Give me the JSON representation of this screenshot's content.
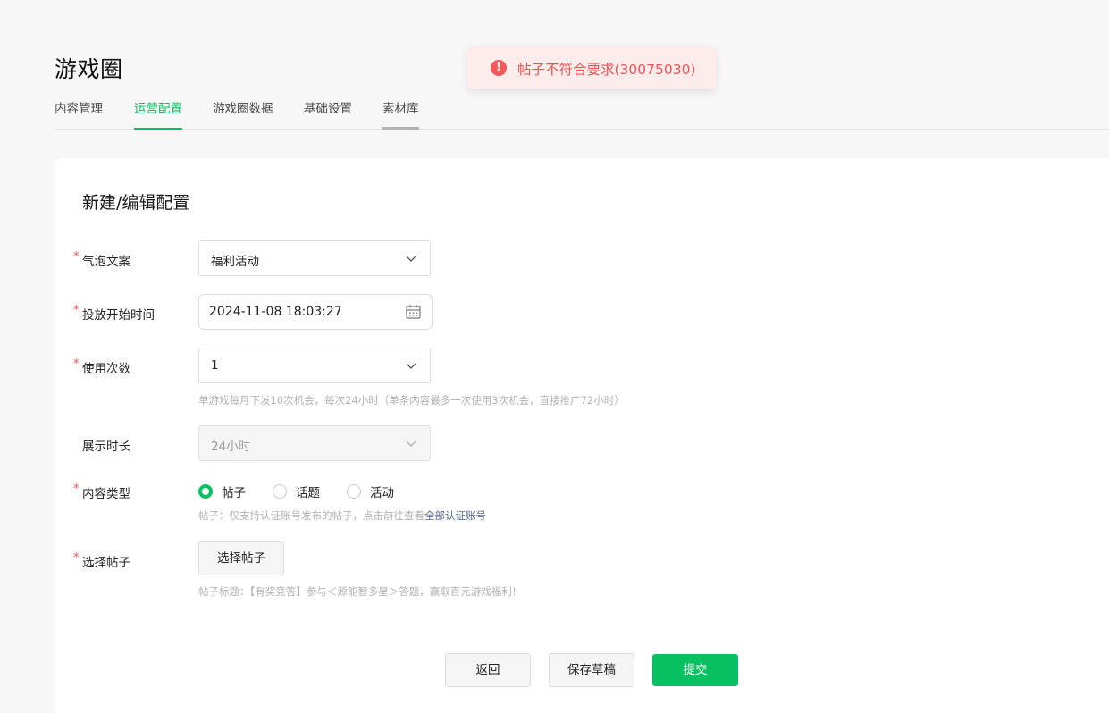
{
  "page": {
    "title": "游戏圈"
  },
  "tabs": [
    {
      "label": "内容管理",
      "active": false
    },
    {
      "label": "运营配置",
      "active": true
    },
    {
      "label": "游戏圈数据",
      "active": false
    },
    {
      "label": "基础设置",
      "active": false
    },
    {
      "label": "素材库",
      "active": false
    }
  ],
  "toast": {
    "icon": "error-icon",
    "icon_glyph": "!",
    "message": "帖子不符合要求(30075030)",
    "color": "#f05353"
  },
  "form": {
    "title": "新建/编辑配置",
    "required_mark": "*",
    "bubble_text": {
      "label": "气泡文案",
      "value": "福利活动"
    },
    "start_time": {
      "label": "投放开始时间",
      "value": "2024-11-08 18:03:27"
    },
    "use_count": {
      "label": "使用次数",
      "value": "1",
      "hint": "单游戏每月下发10次机会，每次24小时（单条内容最多一次使用3次机会，直接推广72小时）"
    },
    "display_duration": {
      "label": "展示时长",
      "value": "24小时"
    },
    "content_type": {
      "label": "内容类型",
      "options": [
        "帖子",
        "话题",
        "活动"
      ],
      "selected": "帖子",
      "hint_prefix": "帖子：仅支持认证账号发布的帖子，点击前往查看",
      "hint_link": "全部认证账号"
    },
    "select_post": {
      "label": "选择帖子",
      "button": "选择帖子",
      "hint": "帖子标题：【有奖竞答】参与＜源能智多星＞答题，赢取百元游戏福利！"
    }
  },
  "actions": {
    "back": "返回",
    "save_draft": "保存草稿",
    "submit": "提交"
  },
  "colors": {
    "accent": "#07c160",
    "required": "#fa5151",
    "link": "#576b95"
  }
}
